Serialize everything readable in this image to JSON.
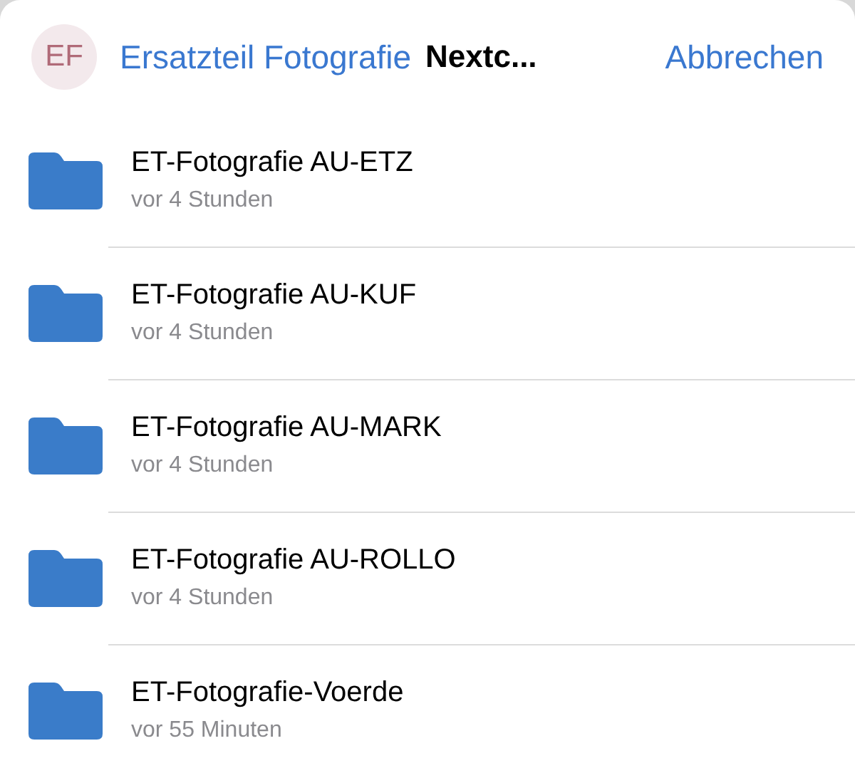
{
  "header": {
    "avatar": "EF",
    "account": "Ersatzteil Fotografie",
    "title": "Nextc...",
    "cancel": "Abbrechen"
  },
  "items": [
    {
      "name": "ET-Fotografie AU-ETZ",
      "modified": "vor 4 Stunden"
    },
    {
      "name": "ET-Fotografie AU-KUF",
      "modified": "vor 4 Stunden"
    },
    {
      "name": "ET-Fotografie AU-MARK",
      "modified": "vor 4 Stunden"
    },
    {
      "name": "ET-Fotografie AU-ROLLO",
      "modified": "vor 4 Stunden"
    },
    {
      "name": "ET-Fotografie-Voerde",
      "modified": "vor 55 Minuten"
    }
  ]
}
